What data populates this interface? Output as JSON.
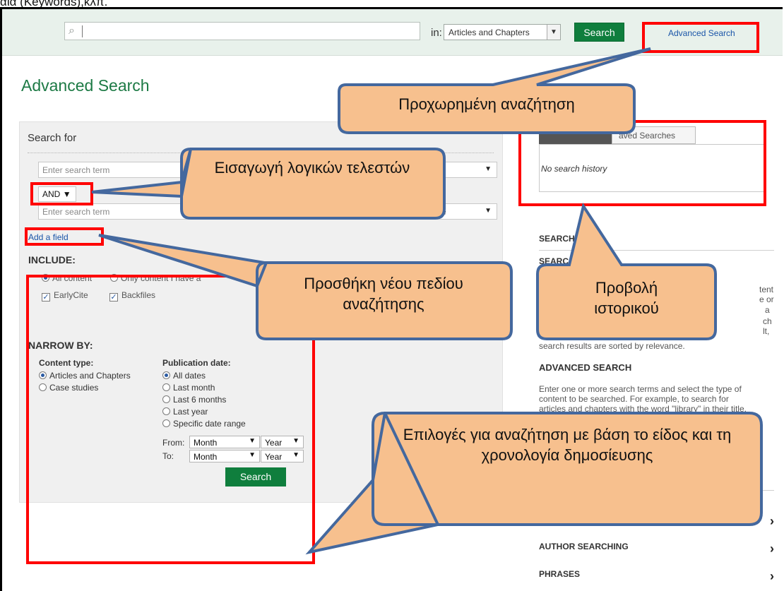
{
  "caption": "αία (Keywords),κλπ.",
  "topbar": {
    "search_value": "",
    "in_label": "in:",
    "scope_value": "Articles and Chapters",
    "search_button": "Search",
    "advanced_link": "Advanced Search"
  },
  "page_title": "Advanced Search",
  "search_for": {
    "title": "Search for",
    "term1_placeholder": "Enter search term",
    "operator": "AND",
    "term2_placeholder": "Enter search term",
    "field2_partial": "e",
    "add_field": "Add a field"
  },
  "include": {
    "title": "INCLUDE:",
    "options": [
      {
        "label": "All content",
        "checked": true
      },
      {
        "label": "Only content I have a",
        "checked": false
      }
    ],
    "checkboxes": [
      {
        "label": "EarlyCite",
        "checked": true
      },
      {
        "label": "Backfiles",
        "checked": true
      }
    ]
  },
  "narrow_by": {
    "title": "NARROW BY:",
    "content_type_title": "Content type:",
    "content_types": [
      {
        "label": "Articles and Chapters",
        "checked": true
      },
      {
        "label": "Case studies",
        "checked": false
      }
    ],
    "publication_date_title": "Publication date:",
    "dates": [
      {
        "label": "All dates",
        "checked": true
      },
      {
        "label": "Last month",
        "checked": false
      },
      {
        "label": "Last 6 months",
        "checked": false
      },
      {
        "label": "Last year",
        "checked": false
      },
      {
        "label": "Specific date range",
        "checked": false
      }
    ],
    "from_label": "From:",
    "to_label": "To:",
    "month_value": "Month",
    "year_value": "Year",
    "search_button": "Search"
  },
  "history": {
    "tab_saved": "aved Searches",
    "empty": "No search history"
  },
  "right": {
    "search_tips": "SEARCH",
    "search_sub": "SEARC",
    "tent": "tent",
    "e_or": "e or",
    "a_fragment": "a",
    "ch": "ch",
    "lt": "lt,",
    "sorted": "search results are sorted by relevance.",
    "advanced_title": "ADVANCED SEARCH",
    "advanced_text_1": "Enter one or more search terms and select the type of",
    "advanced_text_2": "content to be searched. For example, to search for",
    "advanced_text_3": "articles and chapters with the word \"library\" in their title,",
    "author_searching": "AUTHOR SEARCHING",
    "phrases": "PHRASES"
  },
  "callouts": {
    "advanced": "Προχωρημένη αναζήτηση",
    "boolean": "Εισαγωγή λογικών τελεστών",
    "new_field": "Προσθήκη νέου πεδίου αναζήτησης",
    "history": "Προβολή ιστορικού",
    "options": "Επιλογές για αναζήτηση με βάση το είδος και τη χρονολογία δημοσίευσης"
  },
  "colors": {
    "accent_green": "#0f7e3d",
    "highlight_red": "#ff0000",
    "callout_fill": "#f7c08e",
    "callout_border": "#44689e"
  }
}
